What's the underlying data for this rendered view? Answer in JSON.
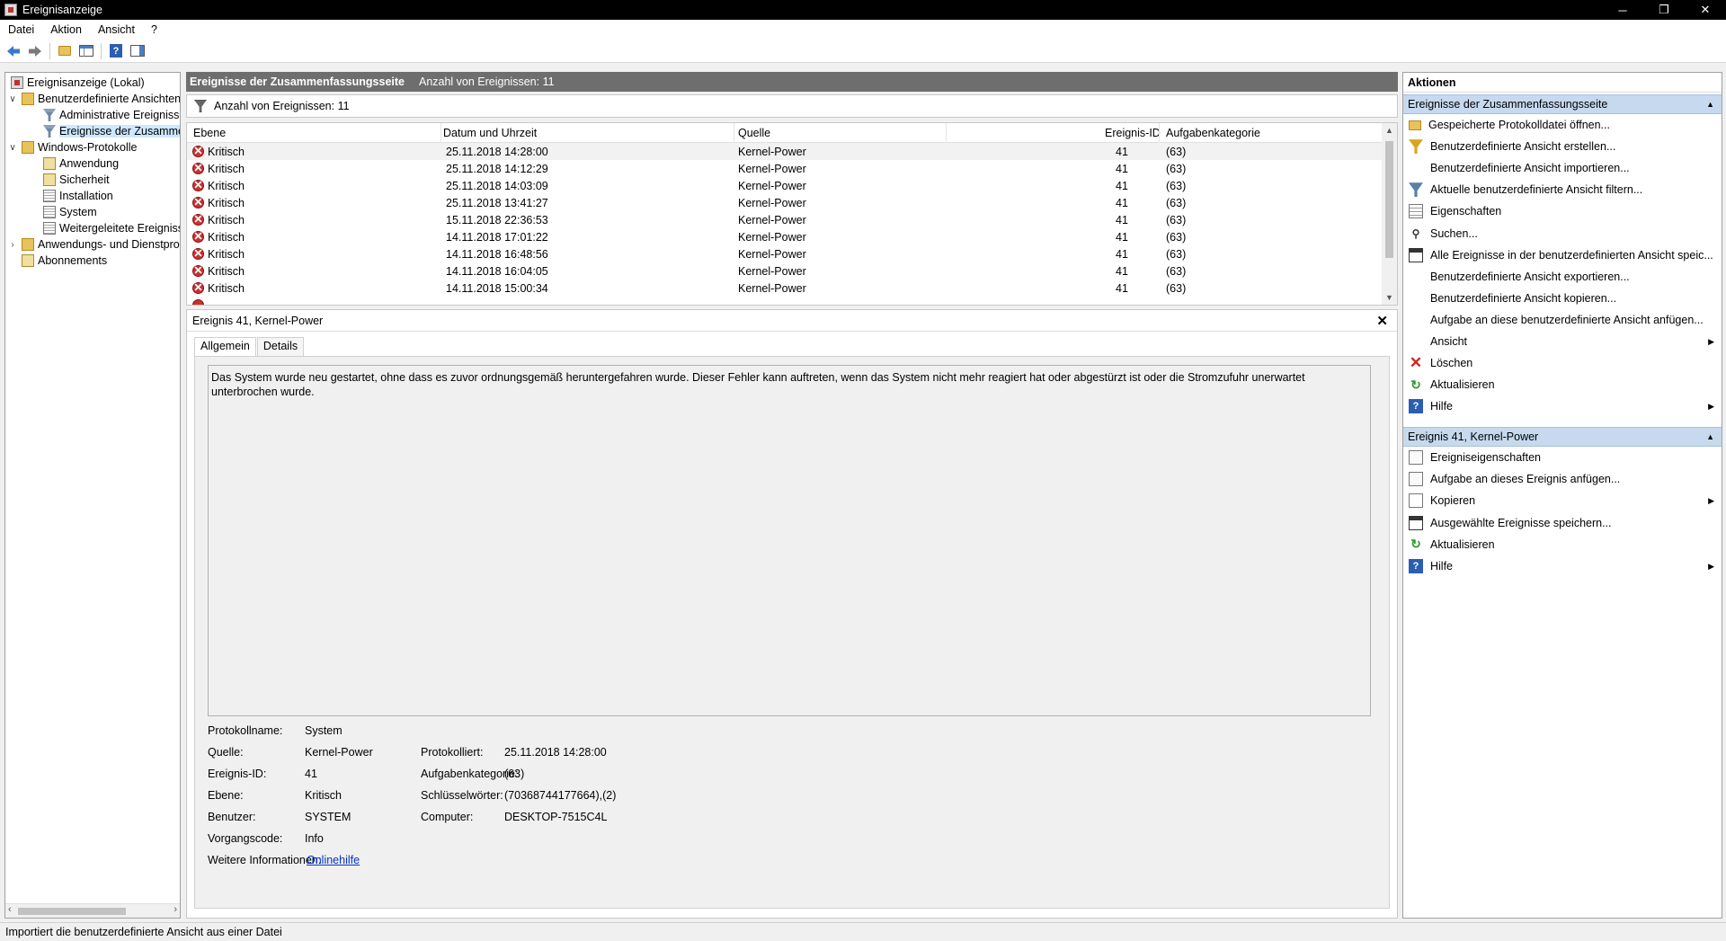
{
  "window": {
    "title": "Ereignisanzeige",
    "controls": {
      "minimize": "─",
      "restore": "❐",
      "close": "✕"
    }
  },
  "menu": [
    "Datei",
    "Aktion",
    "Ansicht",
    "?"
  ],
  "toolbar": {
    "back_icon": "arrow-left-icon",
    "forward_icon": "arrow-right-icon",
    "help_label": "?"
  },
  "tree": {
    "items": [
      {
        "label": "Ereignisanzeige (Lokal)",
        "icon": "event-viewer-icon"
      },
      {
        "label": "Benutzerdefinierte Ansichten",
        "icon": "folder-icon"
      },
      {
        "label": "Administrative Ereignisse",
        "icon": "filter-icon"
      },
      {
        "label": "Ereignisse der Zusammenfassungsseite",
        "icon": "filter-icon",
        "selected": true
      },
      {
        "label": "Windows-Protokolle",
        "icon": "folder-icon"
      },
      {
        "label": "Anwendung",
        "icon": "log-icon"
      },
      {
        "label": "Sicherheit",
        "icon": "log-icon"
      },
      {
        "label": "Installation",
        "icon": "log-icon"
      },
      {
        "label": "System",
        "icon": "log-icon"
      },
      {
        "label": "Weitergeleitete Ereignisse",
        "icon": "log-icon"
      },
      {
        "label": "Anwendungs- und Dienstprotokolle",
        "icon": "folder-icon"
      },
      {
        "label": "Abonnements",
        "icon": "log-icon"
      }
    ],
    "expander_open": "∨",
    "expander_closed": "›"
  },
  "center": {
    "title": "Ereignisse der Zusammenfassungsseite",
    "count_label": "Anzahl von Ereignissen: 11",
    "filter_label": "Anzahl von Ereignissen: 11"
  },
  "grid": {
    "columns": [
      "Ebene",
      "Datum und Uhrzeit",
      "Quelle",
      "Ereignis-ID",
      "Aufgabenkategorie"
    ],
    "rows": [
      {
        "level": "Kritisch",
        "datetime": "25.11.2018 14:28:00",
        "source": "Kernel-Power",
        "id": "41",
        "category": "(63)"
      },
      {
        "level": "Kritisch",
        "datetime": "25.11.2018 14:12:29",
        "source": "Kernel-Power",
        "id": "41",
        "category": "(63)"
      },
      {
        "level": "Kritisch",
        "datetime": "25.11.2018 14:03:09",
        "source": "Kernel-Power",
        "id": "41",
        "category": "(63)"
      },
      {
        "level": "Kritisch",
        "datetime": "25.11.2018 13:41:27",
        "source": "Kernel-Power",
        "id": "41",
        "category": "(63)"
      },
      {
        "level": "Kritisch",
        "datetime": "15.11.2018 22:36:53",
        "source": "Kernel-Power",
        "id": "41",
        "category": "(63)"
      },
      {
        "level": "Kritisch",
        "datetime": "14.11.2018 17:01:22",
        "source": "Kernel-Power",
        "id": "41",
        "category": "(63)"
      },
      {
        "level": "Kritisch",
        "datetime": "14.11.2018 16:48:56",
        "source": "Kernel-Power",
        "id": "41",
        "category": "(63)"
      },
      {
        "level": "Kritisch",
        "datetime": "14.11.2018 16:04:05",
        "source": "Kernel-Power",
        "id": "41",
        "category": "(63)"
      },
      {
        "level": "Kritisch",
        "datetime": "14.11.2018 15:00:34",
        "source": "Kernel-Power",
        "id": "41",
        "category": "(63)"
      }
    ]
  },
  "detail": {
    "title": "Ereignis 41, Kernel-Power",
    "close": "✕",
    "tabs": [
      "Allgemein",
      "Details"
    ],
    "description": "Das System wurde neu gestartet, ohne dass es zuvor ordnungsgemäß heruntergefahren wurde. Dieser Fehler kann auftreten, wenn das System nicht mehr reagiert hat oder abgestürzt ist oder die Stromzufuhr unerwartet unterbrochen wurde.",
    "props": {
      "log_name_label": "Protokollname:",
      "log_name": "System",
      "source_label": "Quelle:",
      "source": "Kernel-Power",
      "logged_label": "Protokolliert:",
      "logged": "25.11.2018 14:28:00",
      "event_id_label": "Ereignis-ID:",
      "event_id": "41",
      "task_cat_label": "Aufgabenkategorie:",
      "task_cat": "(63)",
      "level_label": "Ebene:",
      "level": "Kritisch",
      "keywords_label": "Schlüsselwörter:",
      "keywords": "(70368744177664),(2)",
      "user_label": "Benutzer:",
      "user": "SYSTEM",
      "computer_label": "Computer:",
      "computer": "DESKTOP-7515C4L",
      "opcode_label": "Vorgangscode:",
      "opcode": "Info",
      "more_info_label": "Weitere Informationen:",
      "more_info_link": "Onlinehilfe"
    }
  },
  "actions": {
    "title": "Aktionen",
    "section1": {
      "title": "Ereignisse der Zusammenfassungsseite",
      "items": [
        {
          "label": "Gespeicherte Protokolldatei öffnen...",
          "icon": "open-folder-icon"
        },
        {
          "label": "Benutzerdefinierte Ansicht erstellen...",
          "icon": "filter-icon"
        },
        {
          "label": "Benutzerdefinierte Ansicht importieren...",
          "icon": ""
        },
        {
          "label": "Aktuelle benutzerdefinierte Ansicht filtern...",
          "icon": "filter-icon"
        },
        {
          "label": "Eigenschaften",
          "icon": "properties-icon"
        },
        {
          "label": "Suchen...",
          "icon": "binoculars-icon"
        },
        {
          "label": "Alle Ereignisse in der benutzerdefinierten Ansicht speic...",
          "icon": "save-icon"
        },
        {
          "label": "Benutzerdefinierte Ansicht exportieren...",
          "icon": ""
        },
        {
          "label": "Benutzerdefinierte Ansicht kopieren...",
          "icon": ""
        },
        {
          "label": "Aufgabe an diese benutzerdefinierte Ansicht anfügen...",
          "icon": ""
        },
        {
          "label": "Ansicht",
          "icon": "",
          "submenu": true
        },
        {
          "label": "Löschen",
          "icon": "delete-icon"
        },
        {
          "label": "Aktualisieren",
          "icon": "refresh-icon"
        },
        {
          "label": "Hilfe",
          "icon": "help-icon",
          "submenu": true
        }
      ]
    },
    "section2": {
      "title": "Ereignis 41, Kernel-Power",
      "items": [
        {
          "label": "Ereigniseigenschaften",
          "icon": "event-properties-icon"
        },
        {
          "label": "Aufgabe an dieses Ereignis anfügen...",
          "icon": "task-icon"
        },
        {
          "label": "Kopieren",
          "icon": "copy-icon",
          "submenu": true
        },
        {
          "label": "Ausgewählte Ereignisse speichern...",
          "icon": "save-icon"
        },
        {
          "label": "Aktualisieren",
          "icon": "refresh-icon"
        },
        {
          "label": "Hilfe",
          "icon": "help-icon",
          "submenu": true
        }
      ]
    }
  },
  "status": {
    "text": "Importiert die benutzerdefinierte Ansicht aus einer Datei"
  }
}
